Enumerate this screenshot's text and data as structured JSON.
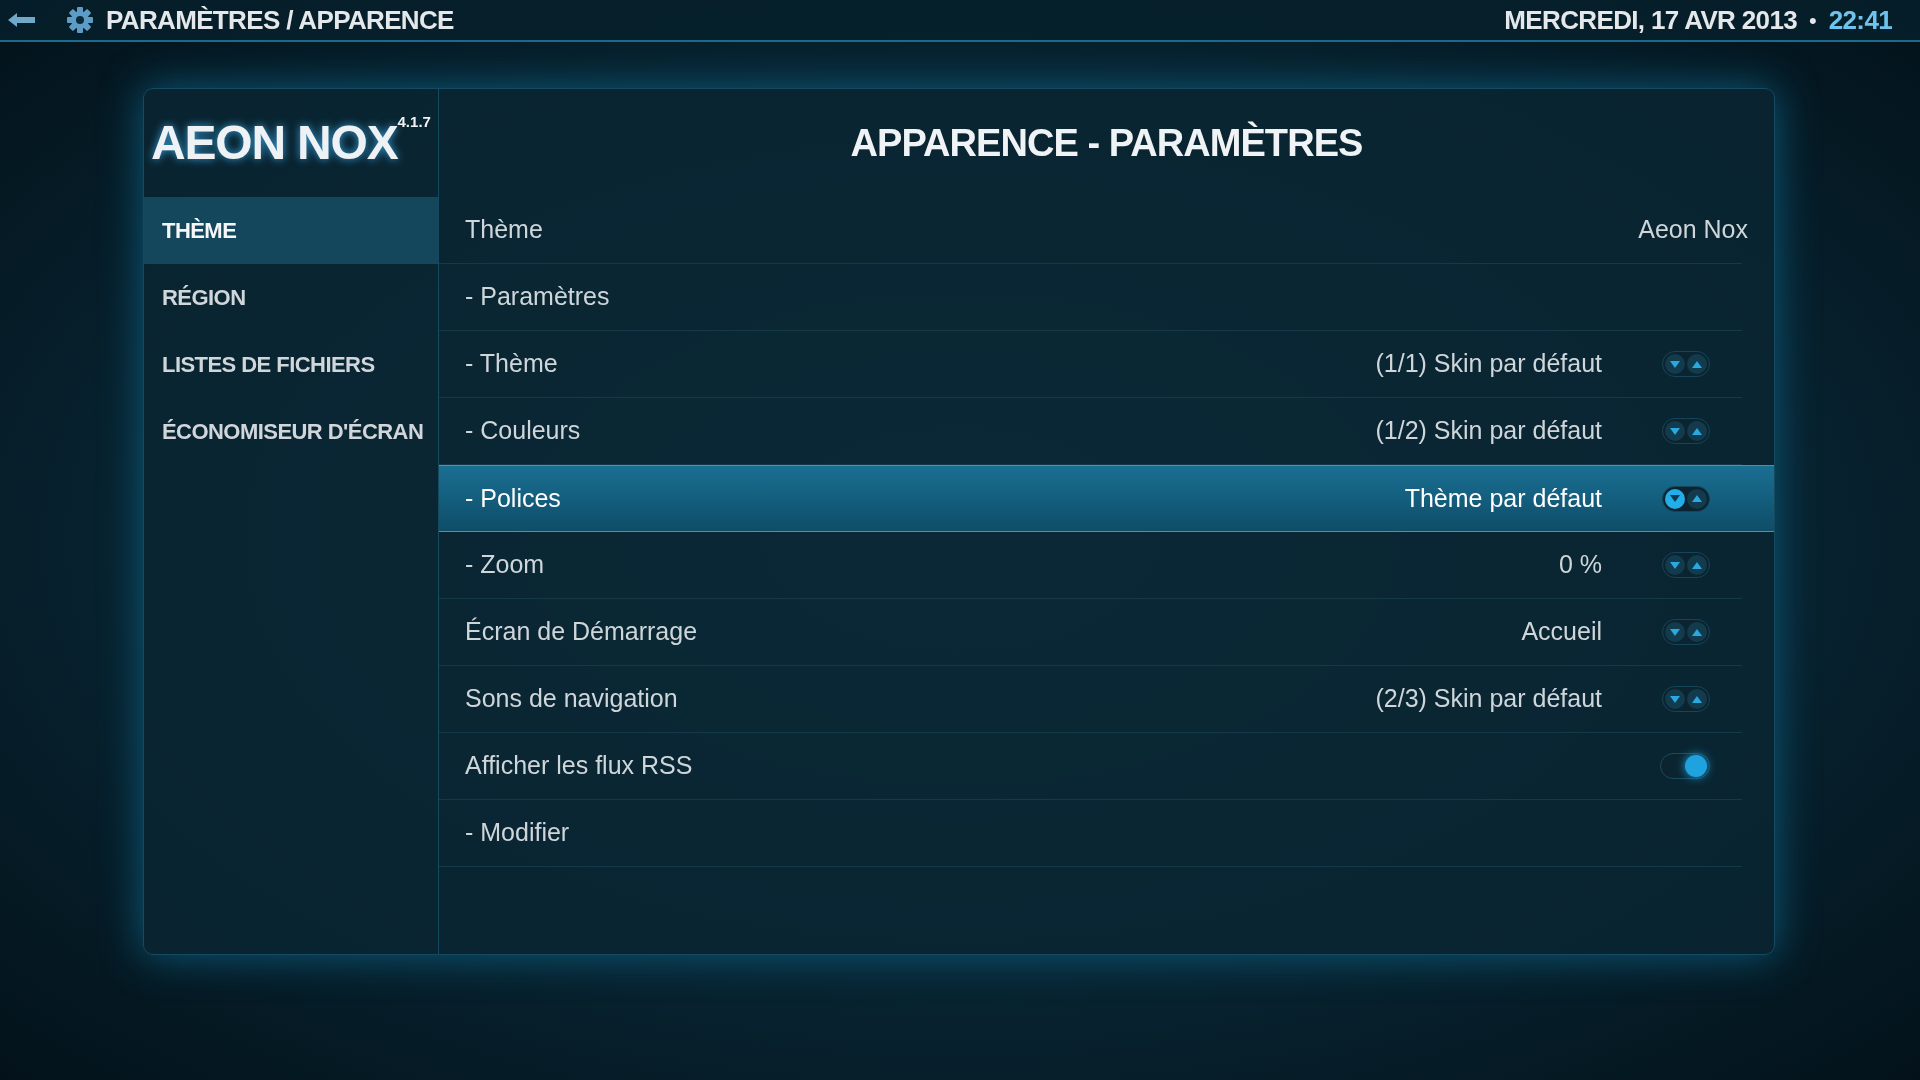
{
  "top_bar": {
    "breadcrumb": "PARAMÈTRES / APPARENCE",
    "date": "MERCREDI, 17 AVR 2013",
    "separator": "•",
    "time": "22:41"
  },
  "logo": {
    "name": "AEON NOX",
    "version": "4.1.7"
  },
  "title": "APPARENCE - PARAMÈTRES",
  "sidebar": {
    "items": [
      {
        "label": "THÈME",
        "selected": true
      },
      {
        "label": "RÉGION",
        "selected": false
      },
      {
        "label": "LISTES DE FICHIERS",
        "selected": false
      },
      {
        "label": "ÉCONOMISEUR D'ÉCRAN",
        "selected": false
      }
    ]
  },
  "settings": [
    {
      "kind": "value",
      "label": "Thème",
      "value": "Aeon Nox",
      "selected": false
    },
    {
      "kind": "action",
      "label": "- Paramètres",
      "selected": false
    },
    {
      "kind": "spinner",
      "label": "- Thème",
      "value": "(1/1) Skin par défaut",
      "selected": false
    },
    {
      "kind": "spinner",
      "label": "- Couleurs",
      "value": "(1/2) Skin par défaut",
      "selected": false
    },
    {
      "kind": "spinner",
      "label": "- Polices",
      "value": "Thème par défaut",
      "selected": true
    },
    {
      "kind": "spinner",
      "label": "- Zoom",
      "value": "0 %",
      "selected": false
    },
    {
      "kind": "spinner",
      "label": "Écran de Démarrage",
      "value": "Accueil",
      "selected": false
    },
    {
      "kind": "spinner",
      "label": "Sons de navigation",
      "value": "(2/3) Skin par défaut",
      "selected": false
    },
    {
      "kind": "toggle",
      "label": "Afficher les flux RSS",
      "on": true,
      "selected": false
    },
    {
      "kind": "action",
      "label": "- Modifier",
      "selected": false
    }
  ]
}
